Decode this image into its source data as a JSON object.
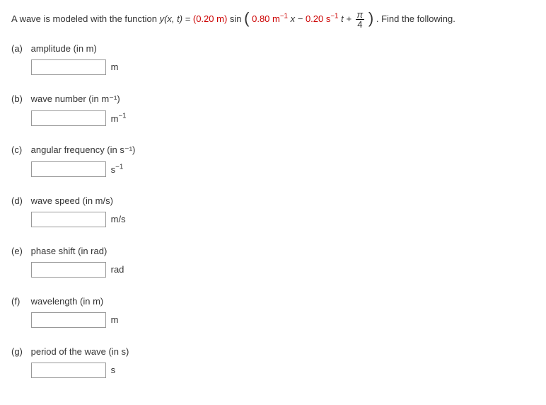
{
  "intro": {
    "lead": "A wave is modeled with the function ",
    "yfunc": "y(x, t) = ",
    "amp_red": "(0.20 m)",
    "sin": "sin",
    "arg_red_1": " 0.80 m",
    "arg_red_1_exp": "−1",
    "arg_var_x": " x − ",
    "arg_red_2": "0.20 s",
    "arg_red_2_exp": "−1",
    "arg_var_t": " t + ",
    "frac_num": "π",
    "frac_den": "4",
    "trail": ". Find the following."
  },
  "questions": [
    {
      "marker": "(a)",
      "label": "amplitude (in m)",
      "unit": "m"
    },
    {
      "marker": "(b)",
      "label": "wave number (in m⁻¹)",
      "unit_html": "m<sup>−1</sup>"
    },
    {
      "marker": "(c)",
      "label": "angular frequency (in s⁻¹)",
      "unit_html": "s<sup>−1</sup>"
    },
    {
      "marker": "(d)",
      "label": "wave speed (in m/s)",
      "unit": "m/s"
    },
    {
      "marker": "(e)",
      "label": "phase shift (in rad)",
      "unit": "rad"
    },
    {
      "marker": "(f)",
      "label": "wavelength (in m)",
      "unit": "m"
    },
    {
      "marker": "(g)",
      "label": "period of the wave (in s)",
      "unit": "s"
    }
  ]
}
